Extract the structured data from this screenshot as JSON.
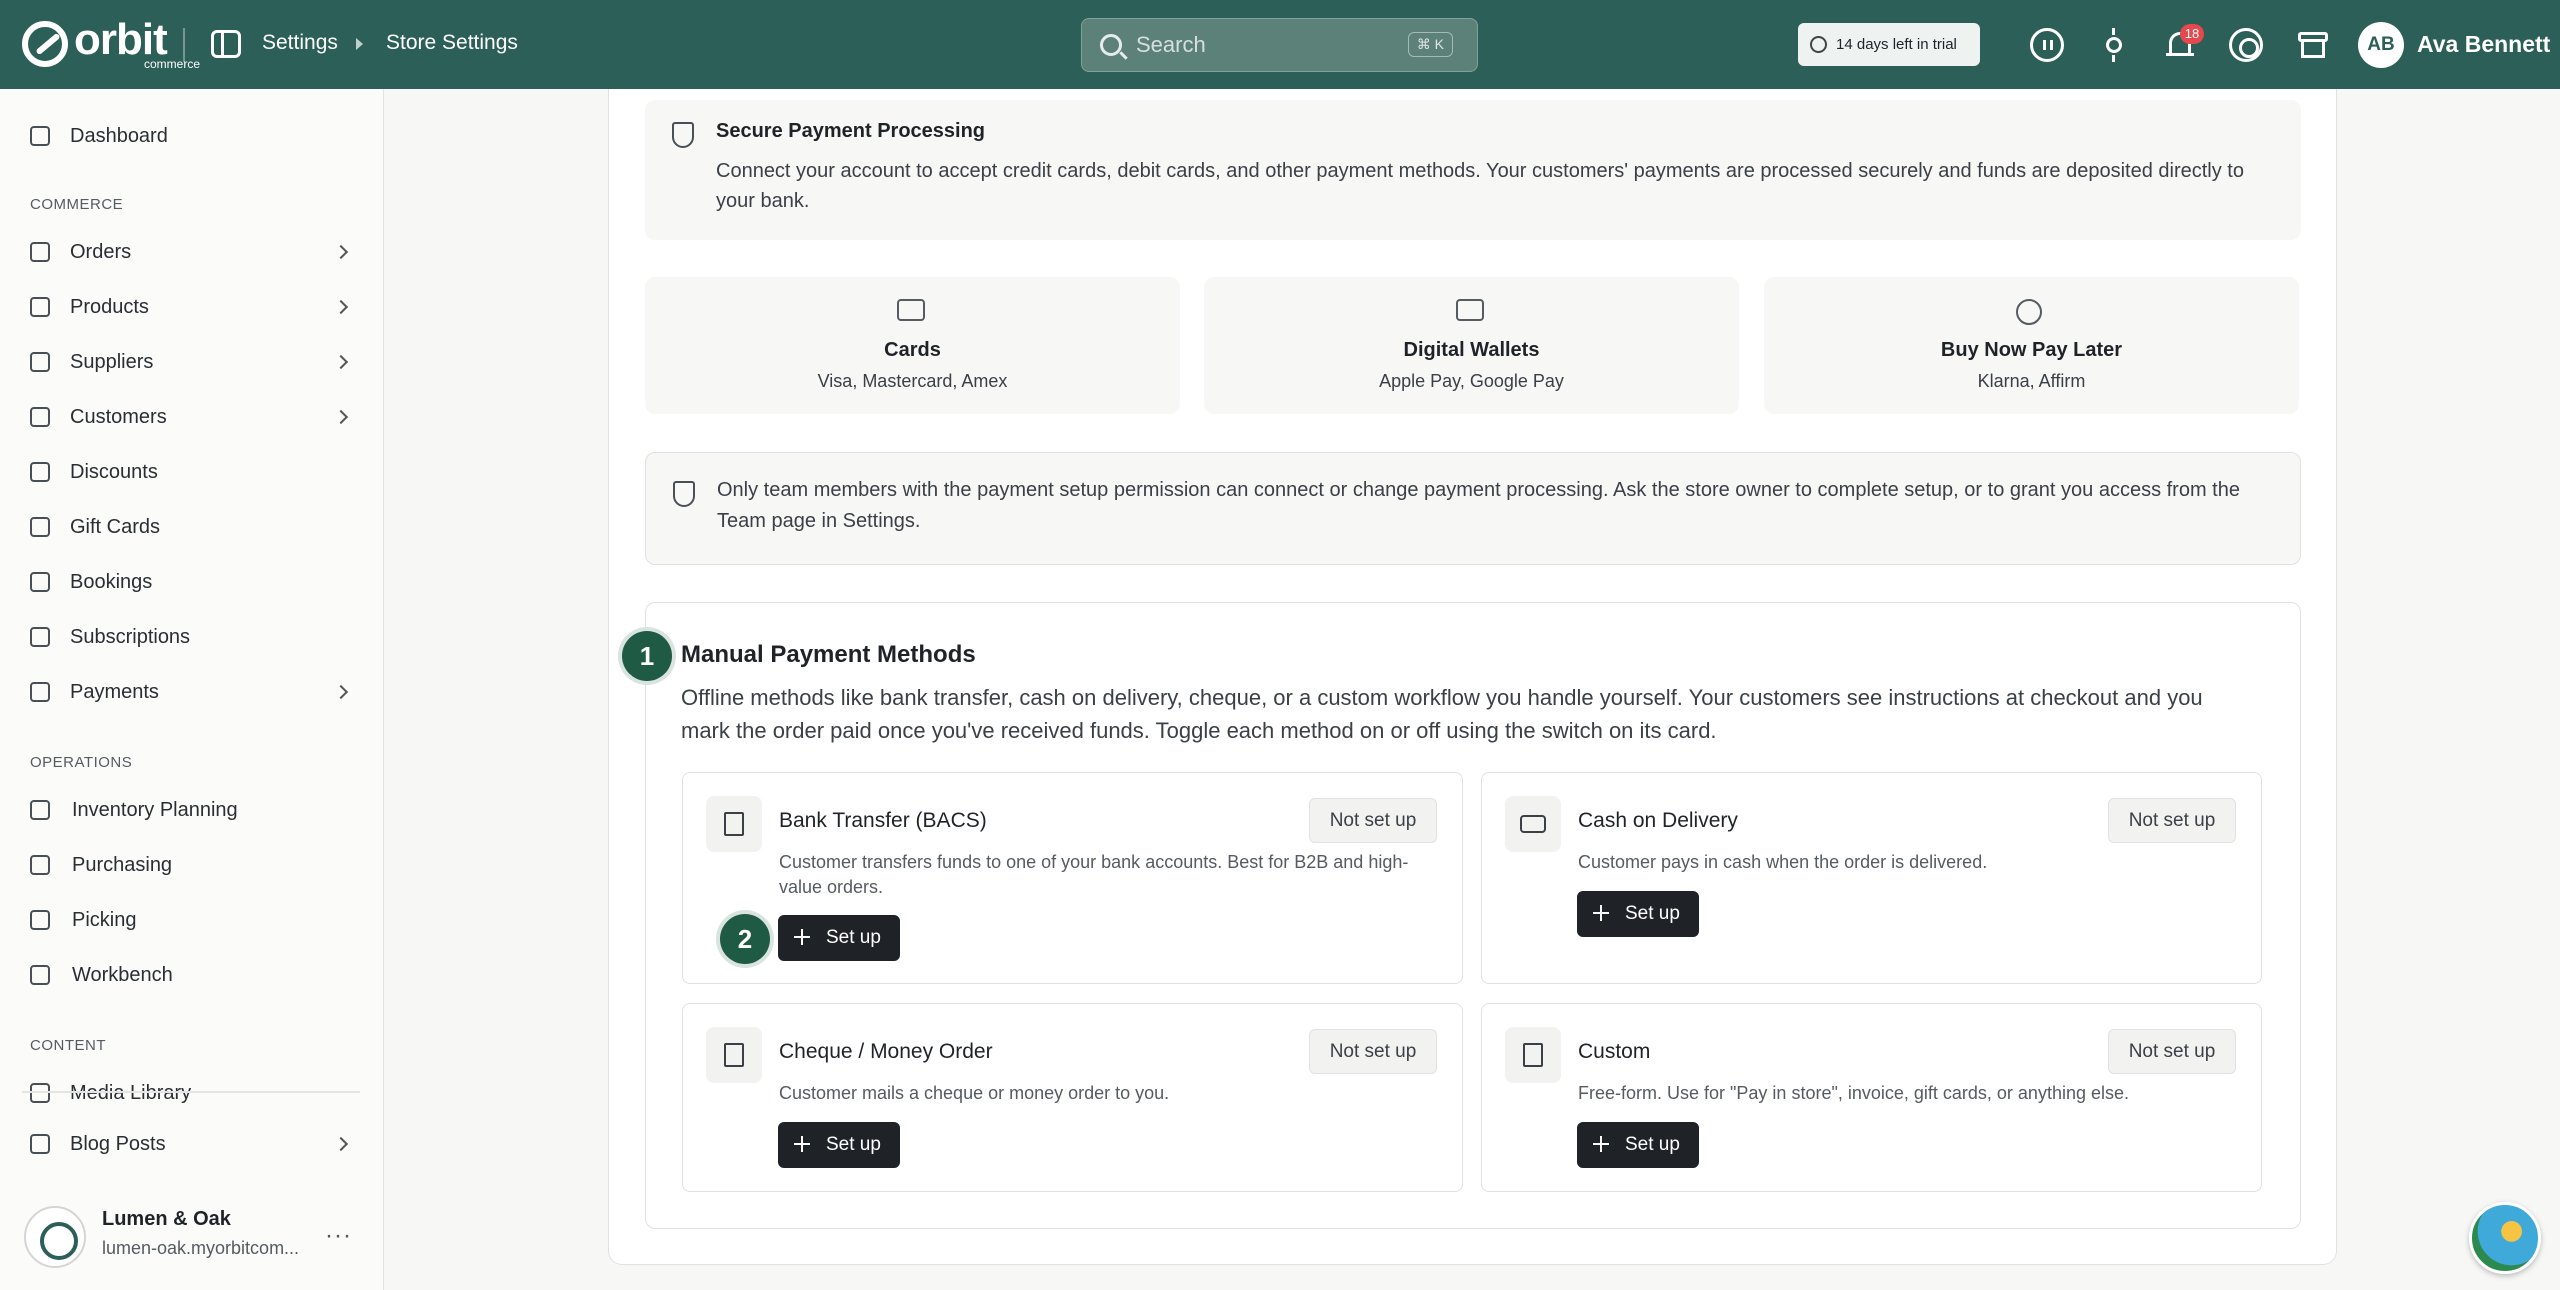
{
  "brand": {
    "logo_word": "orbit",
    "logo_sub": "commerce"
  },
  "breadcrumb": [
    "Settings",
    "Store Settings"
  ],
  "search": {
    "placeholder": "Search",
    "shortcut": "⌘ K"
  },
  "trial": {
    "label": "14 days left in trial"
  },
  "notifications": {
    "count": "18"
  },
  "user": {
    "initials": "AB",
    "name": "Ava Bennett"
  },
  "sidebar": {
    "items": [
      {
        "label": "Dashboard",
        "icon": "dashboard-icon"
      },
      {
        "label": "Orders",
        "icon": "orders-icon"
      },
      {
        "label": "Products",
        "icon": "products-icon"
      },
      {
        "label": "Suppliers",
        "icon": "suppliers-icon"
      },
      {
        "label": "Customers",
        "icon": "customers-icon"
      },
      {
        "label": "Discounts",
        "icon": "tag-icon"
      },
      {
        "label": "Gift Cards",
        "icon": "gift-icon"
      },
      {
        "label": "Bookings",
        "icon": "calendar-icon"
      },
      {
        "label": "Subscriptions",
        "icon": "subscriptions-icon"
      },
      {
        "label": "Payments",
        "icon": "card-icon"
      },
      {
        "label": "Inventory Planning",
        "icon": "inventory-icon"
      },
      {
        "label": "Purchasing",
        "icon": "purchasing-icon"
      },
      {
        "label": "Picking",
        "icon": "location-icon"
      },
      {
        "label": "Workbench",
        "icon": "workbench-icon"
      },
      {
        "label": "Media Library",
        "icon": "image-icon"
      },
      {
        "label": "Blog Posts",
        "icon": "blog-icon"
      }
    ],
    "sections": [
      "COMMERCE",
      "OPERATIONS",
      "CONTENT"
    ],
    "store": {
      "name": "Lumen & Oak",
      "domain": "lumen-oak.myorbitcom..."
    }
  },
  "secure": {
    "title": "Secure Payment Processing",
    "text": "Connect your account to accept credit cards, debit cards, and other payment methods. Your customers' payments are processed securely and funds are deposited directly to your bank."
  },
  "methods": [
    {
      "title": "Cards",
      "sub": "Visa, Mastercard, Amex"
    },
    {
      "title": "Digital Wallets",
      "sub": "Apple Pay, Google Pay"
    },
    {
      "title": "Buy Now Pay Later",
      "sub": "Klarna, Affirm"
    }
  ],
  "notice": {
    "text": "Only team members with the payment setup permission can connect or change payment processing. Ask the store owner to complete setup, or to grant you access from the Team page in Settings."
  },
  "manual": {
    "step": "1",
    "title": "Manual Payment Methods",
    "desc": "Offline methods like bank transfer, cash on delivery, cheque, or a custom workflow you handle yourself. Your customers see instructions at checkout and you mark the order paid once you've received funds. Toggle each method on or off using the switch on its card.",
    "step2": "2",
    "cards": [
      {
        "title": "Bank Transfer (BACS)",
        "desc": "Customer transfers funds to one of your bank accounts. Best for B2B and high-value orders.",
        "status": "Not set up",
        "action": "Set up"
      },
      {
        "title": "Cash on Delivery",
        "desc": "Customer pays in cash when the order is delivered.",
        "status": "Not set up",
        "action": "Set up"
      },
      {
        "title": "Cheque / Money Order",
        "desc": "Customer mails a cheque or money order to you.",
        "status": "Not set up",
        "action": "Set up"
      },
      {
        "title": "Custom",
        "desc": "Free-form. Use for \"Pay in store\", invoice, gift cards, or anything else.",
        "status": "Not set up",
        "action": "Set up"
      }
    ]
  }
}
